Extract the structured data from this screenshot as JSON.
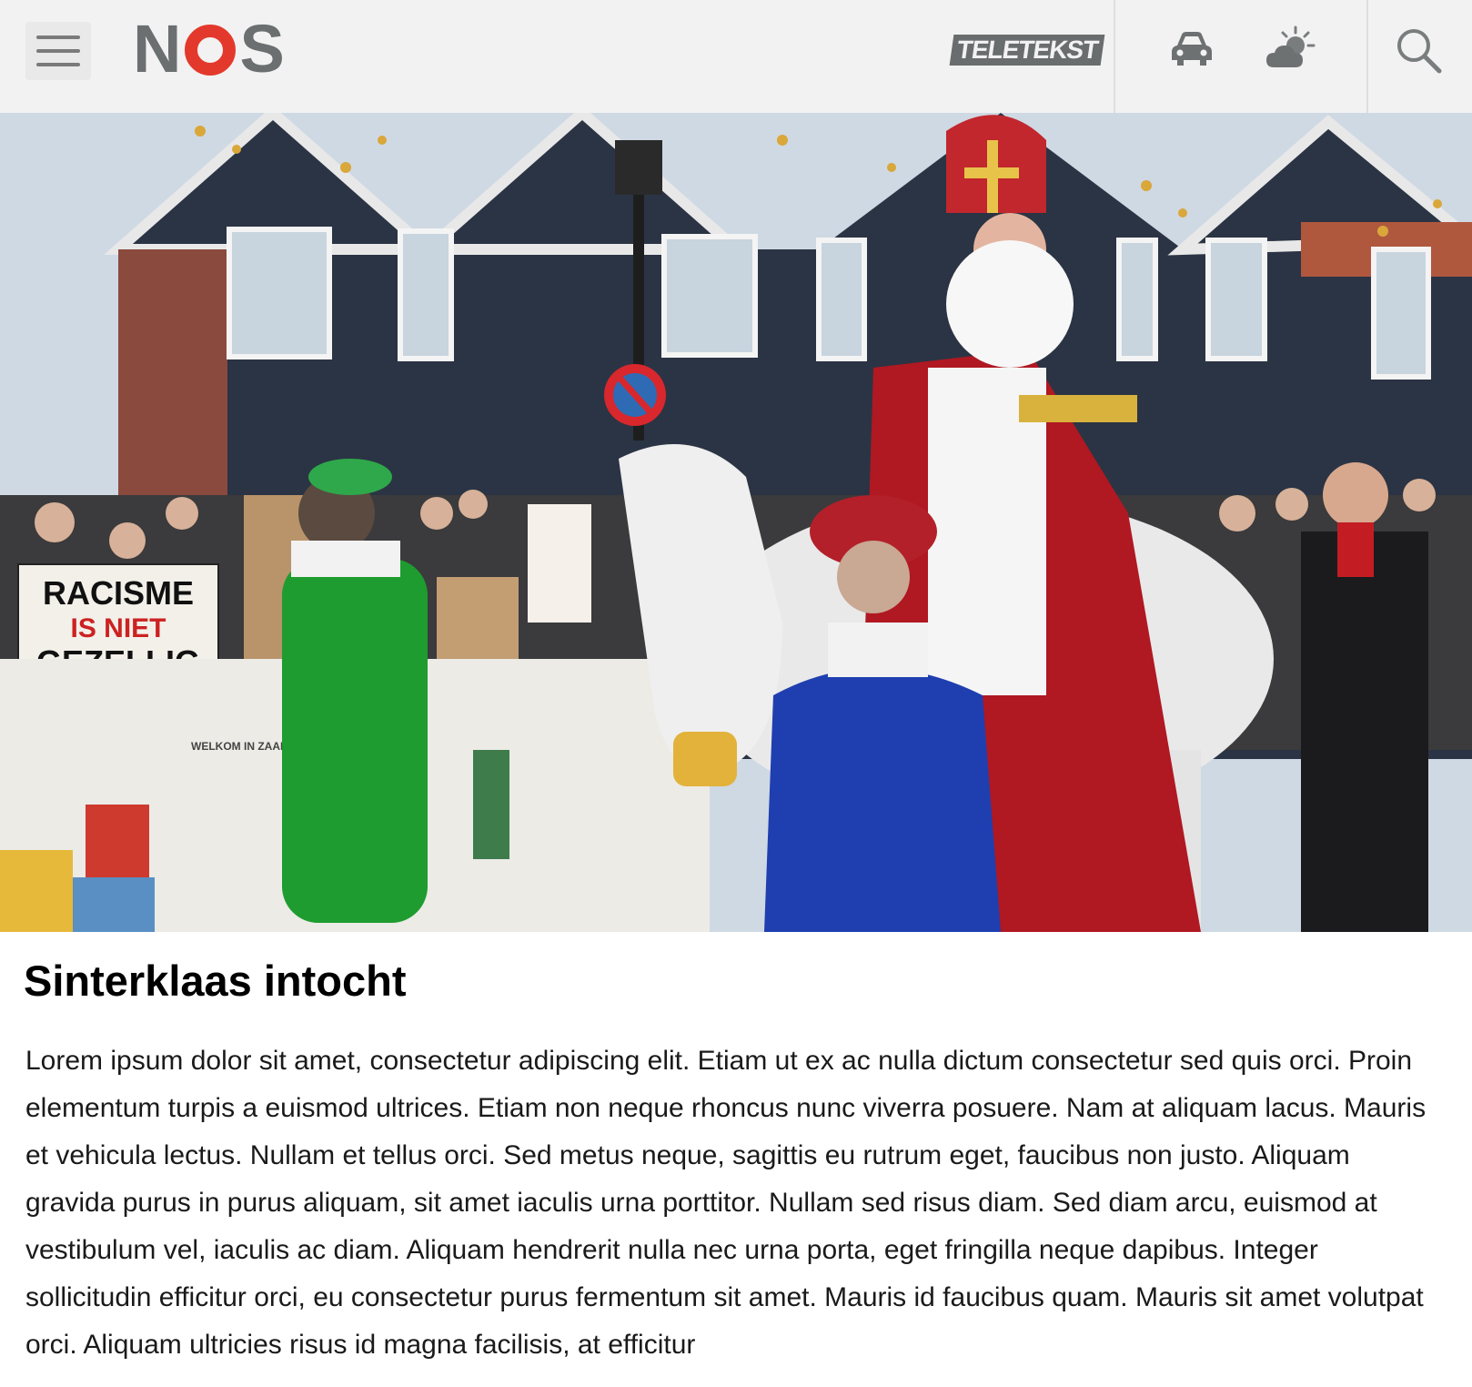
{
  "header": {
    "menu_icon": "hamburger-menu-icon",
    "logo": "NOS",
    "teletekst_label": "TELETEKST",
    "traffic_icon": "car-icon",
    "weather_icon": "weather-sun-cloud-icon",
    "search_icon": "search-icon",
    "colors": {
      "logo_grey": "#6b6f70",
      "logo_red": "#e3392c",
      "header_bg": "#f2f2f2"
    }
  },
  "hero": {
    "image_description": "Sinterklaas parade photo",
    "sign_racisme": [
      "RACISME",
      "IS NIET",
      "GEZELLIG"
    ],
    "banner_text": "WELKOM IN ZAANSTAD"
  },
  "article": {
    "title": "Sinterklaas intocht",
    "body": "Lorem ipsum dolor sit amet, consectetur adipiscing elit. Etiam ut ex ac nulla dictum consectetur sed quis orci. Proin elementum turpis a euismod ultrices. Etiam non neque rhoncus nunc viverra posuere. Nam at aliquam lacus. Mauris et vehicula lectus. Nullam et tellus orci. Sed metus neque, sagittis eu rutrum eget, faucibus non justo. Aliquam gravida purus in purus aliquam, sit amet iaculis urna porttitor. Nullam sed risus diam. Sed diam arcu, euismod at vestibulum vel, iaculis ac diam. Aliquam hendrerit nulla nec urna porta, eget fringilla neque dapibus. Integer sollicitudin efficitur orci, eu consectetur purus fermentum sit amet. Mauris id faucibus quam. Mauris sit amet volutpat orci. Aliquam ultricies risus id magna facilisis, at efficitur"
  }
}
